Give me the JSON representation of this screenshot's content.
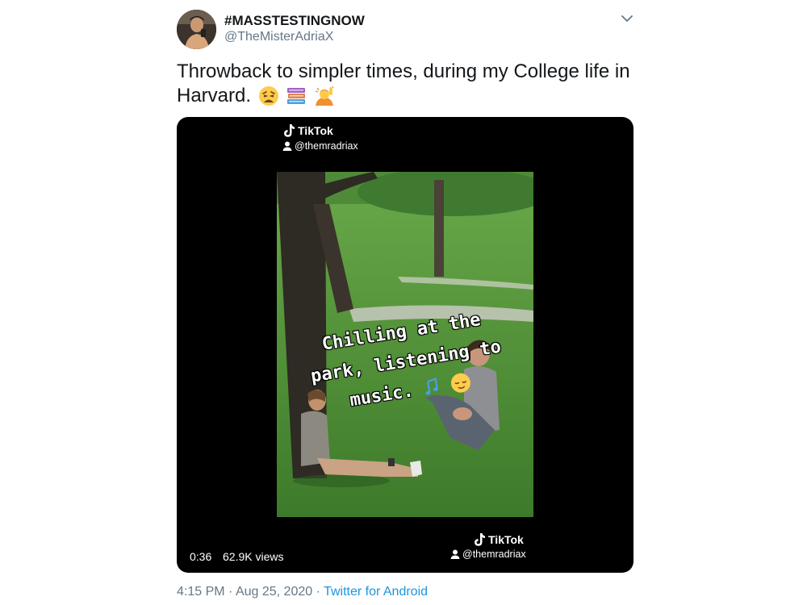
{
  "user": {
    "display_name": "#MASSTESTINGNOW",
    "handle": "@TheMisterAdriaX"
  },
  "tweet": {
    "text_line1": "Throwback to simpler times, during my College life in",
    "text_line2": "Harvard.",
    "emoji": [
      "weary-face-emoji",
      "books-emoji",
      "person-raising-hand-emoji"
    ]
  },
  "video": {
    "watermark_top": {
      "brand": "TikTok",
      "username": "@themradriax"
    },
    "watermark_bottom": {
      "brand": "TikTok",
      "username": "@themradriax"
    },
    "caption_lines": [
      "Chilling at the",
      "park, listening to",
      "music."
    ],
    "duration": "0:36",
    "views": "62.9K views"
  },
  "footer": {
    "time": "4:15 PM",
    "separator": "·",
    "date": "Aug 25, 2020",
    "source": "Twitter for Android"
  },
  "colors": {
    "text": "#14171a",
    "secondary": "#657786",
    "link": "#1b95e0",
    "media_bg": "#000000"
  }
}
